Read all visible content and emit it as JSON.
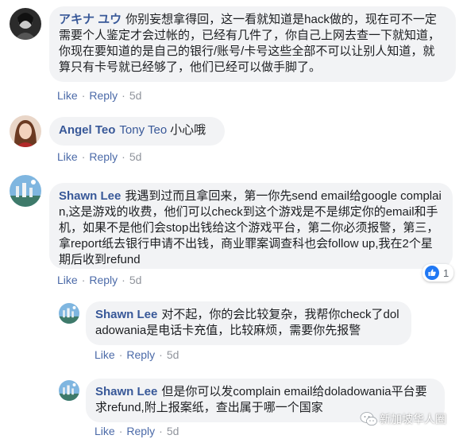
{
  "comments": [
    {
      "author": "アキナ ユウ",
      "text": "你别妄想拿得回，这一看就知道是hack做的，现在可不一定需要个人鉴定才会过帐的，已经有几件了，你自己上网去查一下就知道，你现在要知道的是自己的银行/账号/卡号这些全部不可以让别人知道，就算只有卡号就已经够了，他们已经可以做手脚了。",
      "like": "Like",
      "reply": "Reply",
      "time": "5d"
    },
    {
      "author": "Angel Teo",
      "mention": "Tony Teo",
      "text": "小心哦",
      "like": "Like",
      "reply": "Reply",
      "time": "5d"
    },
    {
      "author": "Shawn Lee",
      "text": "我遇到过而且拿回来，第一你先send email给google complain,这是游戏的收费，他们可以check到这个游戏是不是绑定你的email和手机，如果不是他们会stop出钱给这个游戏平台，第二你必须报警，第三，拿report纸去银行申请不出钱，商业罪案调查科也会follow up,我在2个星期后收到refund",
      "like": "Like",
      "reply": "Reply",
      "time": "5d",
      "reaction_count": "1"
    }
  ],
  "replies": [
    {
      "author": "Shawn Lee",
      "text": "对不起，你的会比较复杂，我帮你check了doladowania是电话卡充值，比较麻烦，需要你先报警",
      "like": "Like",
      "reply": "Reply",
      "time": "5d"
    },
    {
      "author": "Shawn Lee",
      "text": "但是你可以发complain email给doladowania平台要求refund,附上报案纸，查出属于哪一个国家",
      "like": "Like",
      "reply": "Reply",
      "time": "5d"
    }
  ],
  "watermark": "新加坡华人圈",
  "colors": {
    "author": "#385898",
    "bubble": "#f2f3f5",
    "action": "#4b6aa8",
    "meta": "#90949c",
    "like_icon": "#2078f4"
  }
}
